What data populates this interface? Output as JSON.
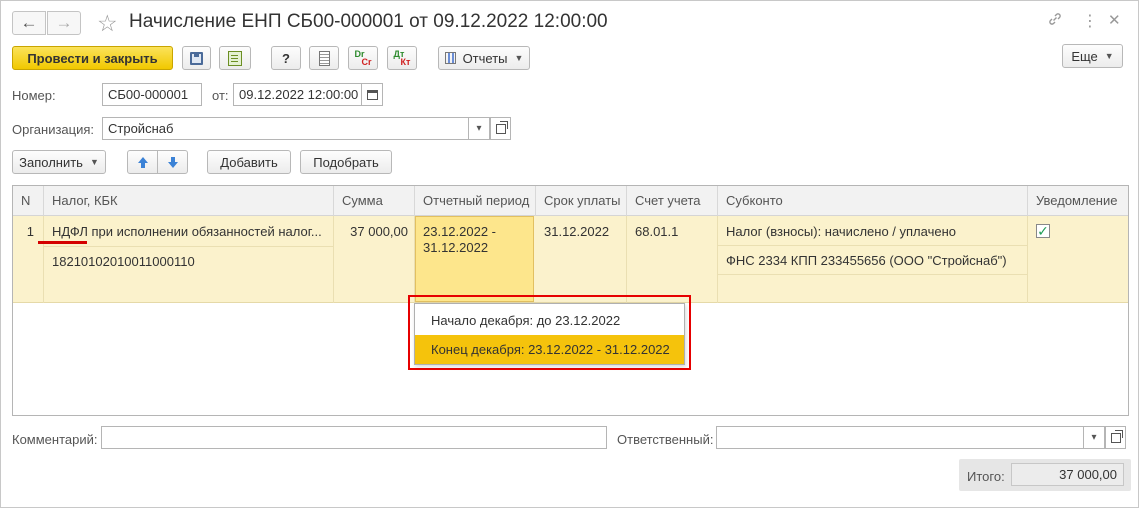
{
  "title": "Начисление ЕНП СБ00-000001 от 09.12.2022 12:00:00",
  "nav": {
    "back": "←",
    "forward": "→",
    "star": "☆",
    "link": "🔗",
    "more": "⋮",
    "close": "✕"
  },
  "toolbar": {
    "post_close": "Провести и закрыть",
    "help": "?",
    "dtkt_dt": "Dr",
    "dtkt_kt": "Cr",
    "dtkt2_dt": "Дт",
    "dtkt2_kt": "Кт",
    "reports": "Отчеты",
    "more": "Еще"
  },
  "form": {
    "number_label": "Номер:",
    "number_value": "СБ00-000001",
    "date_label": "от:",
    "date_value": "09.12.2022 12:00:00",
    "org_label": "Организация:",
    "org_value": "Стройснаб"
  },
  "table_toolbar": {
    "fill": "Заполнить",
    "add": "Добавить",
    "pick": "Подобрать"
  },
  "table": {
    "columns": [
      "N",
      "Налог, КБК",
      "Сумма",
      "Отчетный период",
      "Срок уплаты",
      "Счет учета",
      "Субконто",
      "Уведомление"
    ],
    "rows": [
      {
        "n": "1",
        "tax": "НДФЛ при исполнении обязанностей налог...",
        "kbk": "18210102010011000110",
        "sum": "37 000,00",
        "period_1": "23.12.2022 -",
        "period_2": "31.12.2022",
        "due": "31.12.2022",
        "account": "68.01.1",
        "subconto_1": "Налог (взносы): начислено / уплачено",
        "subconto_2": "ФНС 2334 КПП 233455656 (ООО \"Стройснаб\")",
        "notification": true
      }
    ]
  },
  "period_popup": {
    "items": [
      "Начало декабря: до 23.12.2022",
      "Конец декабря: 23.12.2022 - 31.12.2022"
    ],
    "selected_index": 1
  },
  "footer": {
    "comment_label": "Комментарий:",
    "comment_value": "",
    "responsible_label": "Ответственный:",
    "responsible_value": "",
    "total_label": "Итого:",
    "total_value": "37 000,00"
  },
  "colors": {
    "primary": "#f1c800",
    "row_highlight": "#fbf2cc",
    "popup_selected": "#f5c30c",
    "annotation_red": "#e60000"
  }
}
